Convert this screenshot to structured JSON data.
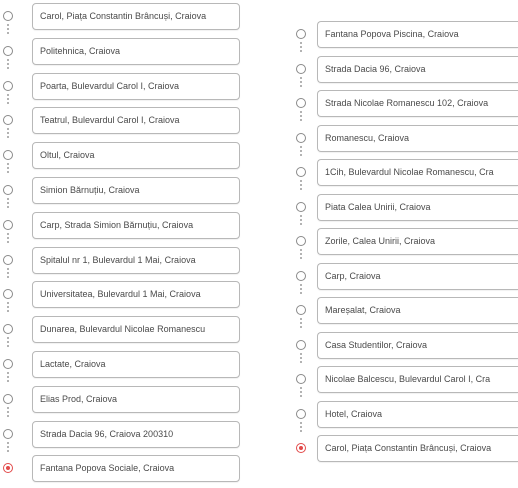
{
  "left_stops": [
    {
      "label": "Carol, Piața Constantin Brâncuși, Craiova",
      "type": "stop"
    },
    {
      "label": "Politehnica, Craiova",
      "type": "stop"
    },
    {
      "label": "Poarta, Bulevardul Carol I, Craiova",
      "type": "stop"
    },
    {
      "label": "Teatrul, Bulevardul Carol I, Craiova",
      "type": "stop"
    },
    {
      "label": "Oltul, Craiova",
      "type": "stop"
    },
    {
      "label": "Simion Bărnuțiu, Craiova",
      "type": "stop"
    },
    {
      "label": "Carp, Strada Simion Bărnuțiu, Craiova",
      "type": "stop"
    },
    {
      "label": "Spitalul nr 1, Bulevardul 1 Mai, Craiova",
      "type": "stop"
    },
    {
      "label": "Universitatea, Bulevardul 1 Mai, Craiova",
      "type": "stop"
    },
    {
      "label": "Dunarea, Bulevardul Nicolae Romanescu",
      "type": "stop"
    },
    {
      "label": "Lactate, Craiova",
      "type": "stop"
    },
    {
      "label": "Elias Prod, Craiova",
      "type": "stop"
    },
    {
      "label": "Strada Dacia 96, Craiova 200310",
      "type": "stop"
    },
    {
      "label": "Fantana Popova Sociale, Craiova",
      "type": "destination"
    }
  ],
  "right_stops": [
    {
      "label": "Fantana Popova Piscina, Craiova",
      "type": "stop"
    },
    {
      "label": "Strada Dacia 96, Craiova",
      "type": "stop"
    },
    {
      "label": "Strada Nicolae Romanescu 102, Craiova",
      "type": "stop"
    },
    {
      "label": "Romanescu, Craiova",
      "type": "stop"
    },
    {
      "label": "1Cih, Bulevardul Nicolae Romanescu, Cra",
      "type": "stop"
    },
    {
      "label": "Piata Calea Unirii, Craiova",
      "type": "stop"
    },
    {
      "label": "Zorile, Calea Unirii, Craiova",
      "type": "stop"
    },
    {
      "label": "Carp, Craiova",
      "type": "stop"
    },
    {
      "label": "Mareșalat, Craiova",
      "type": "stop"
    },
    {
      "label": "Casa Studentilor, Craiova",
      "type": "stop"
    },
    {
      "label": "Nicolae Balcescu, Bulevardul Carol I, Cra",
      "type": "stop"
    },
    {
      "label": "Hotel, Craiova",
      "type": "stop"
    },
    {
      "label": "Carol, Piața Constantin Brâncuși, Craiova",
      "type": "destination"
    }
  ]
}
